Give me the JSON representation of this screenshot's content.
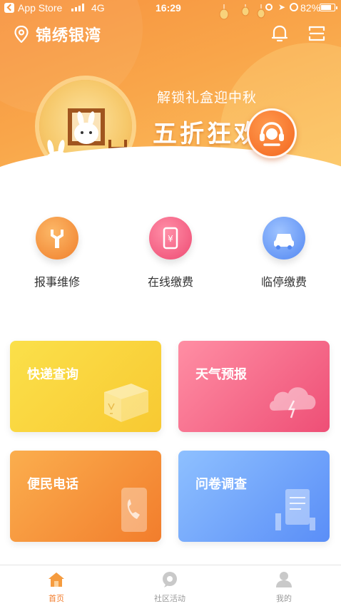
{
  "status_bar": {
    "carrier": "App Store",
    "network": "4G",
    "time": "16:29",
    "battery": "82%"
  },
  "header": {
    "location_name": "锦绣银湾",
    "location_icon": "location-pin-icon",
    "bell_icon": "bell-icon",
    "scan_icon": "scan-icon"
  },
  "banner": {
    "subtitle": "解锁礼盒迎中秋",
    "title": "五折狂欢"
  },
  "quick_actions": [
    {
      "label": "报事维修",
      "icon": "wrench-icon",
      "color": "#f07f2b"
    },
    {
      "label": "在线缴费",
      "icon": "bill-icon",
      "color": "#ee4a72"
    },
    {
      "label": "临停缴费",
      "icon": "car-icon",
      "color": "#5287f2"
    }
  ],
  "cards": [
    {
      "label": "快递查询",
      "icon": "package-icon",
      "color": "#f8c932"
    },
    {
      "label": "天气预报",
      "icon": "cloud-icon",
      "color": "#ee4f76"
    },
    {
      "label": "便民电话",
      "icon": "phone-icon",
      "color": "#f27d2c"
    },
    {
      "label": "问卷调查",
      "icon": "clipboard-icon",
      "color": "#5a8ef7"
    }
  ],
  "tab_bar": [
    {
      "label": "首页",
      "icon": "home-icon",
      "active": true
    },
    {
      "label": "社区活动",
      "icon": "chat-bubble-icon",
      "active": false
    },
    {
      "label": "我的",
      "icon": "user-icon",
      "active": false
    }
  ],
  "colors": {
    "accent": "#f27d2c",
    "tab_inactive": "#999999"
  }
}
